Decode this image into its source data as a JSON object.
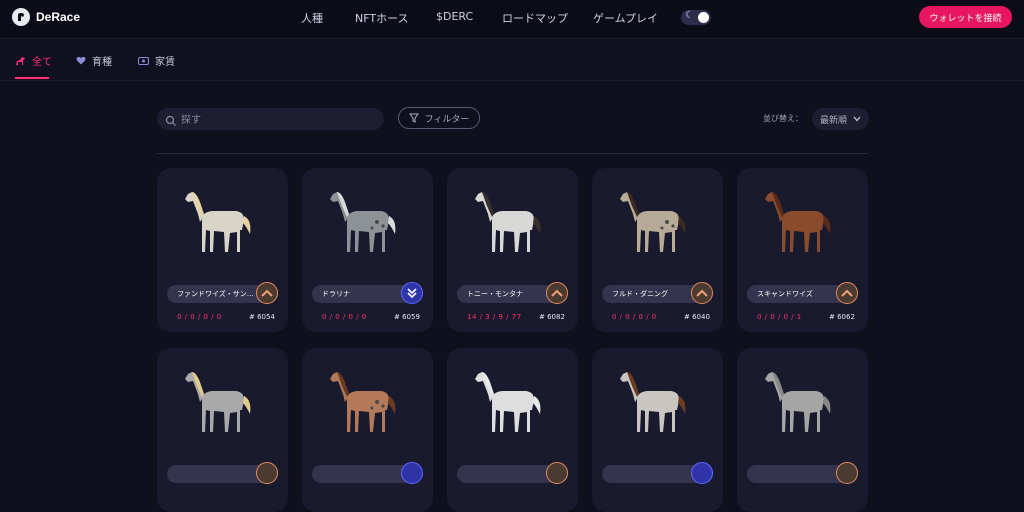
{
  "brand": {
    "name": "DeRace"
  },
  "nav": {
    "items": [
      {
        "label": "人種"
      },
      {
        "label": "NFTホース"
      },
      {
        "label": "$DERC"
      },
      {
        "label": "ロードマップ"
      },
      {
        "label": "ゲームプレイ"
      }
    ],
    "wallet_label": "ウォレットを接続",
    "theme_toggle_icon": "moon-icon"
  },
  "tabs": [
    {
      "label": "全て",
      "icon": "horse-icon",
      "active": true
    },
    {
      "label": "育種",
      "icon": "heart-icon",
      "active": false
    },
    {
      "label": "家賃",
      "icon": "ticket-icon",
      "active": false
    }
  ],
  "controls": {
    "search_placeholder": "探す",
    "filter_label": "フィルター",
    "sort_label": "並び替え：",
    "sort_value": "最新順"
  },
  "colors": {
    "accent": "#e8165f",
    "stat": "#ff2f65",
    "card": "#1a1a2e"
  },
  "horses": [
    {
      "name": "ファンドワイズ・サン…",
      "stats": "0 / 0 / 0 / 0",
      "number": "# 6054",
      "badge": "up",
      "coat": "#d9d4c8",
      "mane": "#e6d3a0",
      "spots": false
    },
    {
      "name": "ドラリナ",
      "stats": "0 / 0 / 0 / 0",
      "number": "# 6059",
      "badge": "down",
      "coat": "#8d9296",
      "mane": "#d8dad8",
      "spots": true
    },
    {
      "name": "トニー・モンタナ",
      "stats": "14 / 3 / 9 / 77",
      "number": "# 6082",
      "badge": "up",
      "coat": "#d8d8d6",
      "mane": "#3a302a",
      "spots": false
    },
    {
      "name": "フルド・ダニング",
      "stats": "0 / 0 / 0 / 0",
      "number": "# 6040",
      "badge": "up",
      "coat": "#b7ab98",
      "mane": "#3b2a1e",
      "spots": true
    },
    {
      "name": "スキャンドワイズ",
      "stats": "0 / 0 / 0 / 1",
      "number": "# 6062",
      "badge": "up",
      "coat": "#8a4a2c",
      "mane": "#5a2b18",
      "spots": false
    },
    {
      "name": "",
      "stats": "",
      "number": "",
      "badge": "up",
      "coat": "#a9a9a9",
      "mane": "#e2cc8a",
      "spots": false
    },
    {
      "name": "",
      "stats": "",
      "number": "",
      "badge": "down",
      "coat": "#b27a58",
      "mane": "#6b3a22",
      "spots": true
    },
    {
      "name": "",
      "stats": "",
      "number": "",
      "badge": "up",
      "coat": "#dedede",
      "mane": "#e8e8e8",
      "spots": false
    },
    {
      "name": "",
      "stats": "",
      "number": "",
      "badge": "down",
      "coat": "#c9c6c2",
      "mane": "#6a3c22",
      "spots": false
    },
    {
      "name": "",
      "stats": "",
      "number": "",
      "badge": "up",
      "coat": "#a5a5a5",
      "mane": "#888888",
      "spots": false
    }
  ]
}
